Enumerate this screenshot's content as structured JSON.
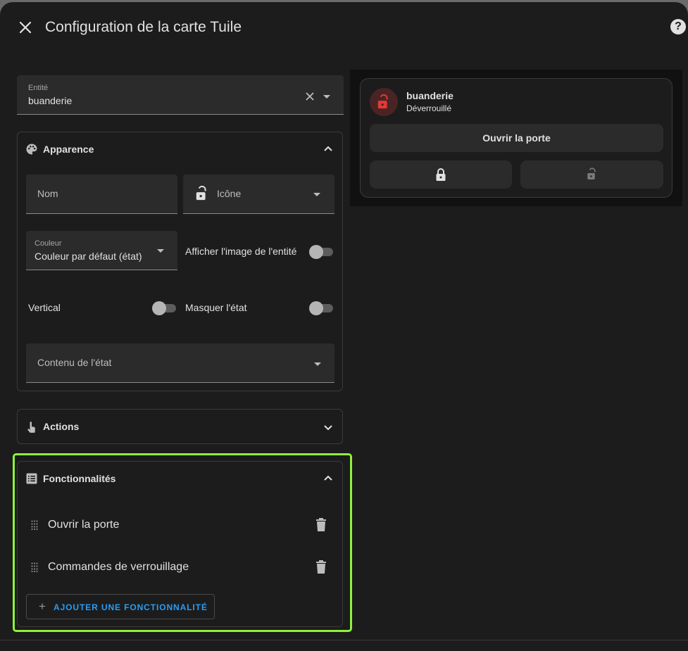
{
  "header": {
    "title": "Configuration de la carte Tuile",
    "close_icon": "close-icon",
    "help_label": "?"
  },
  "entity_field": {
    "label": "Entité",
    "value": "buanderie"
  },
  "appearance": {
    "title": "Apparence",
    "name_field": {
      "placeholder": "Nom"
    },
    "icon_field": {
      "placeholder": "Icône"
    },
    "color_field": {
      "label": "Couleur",
      "value": "Couleur par défaut (état)"
    },
    "show_entity_picture": {
      "label": "Afficher l'image de l'entité",
      "on": false
    },
    "vertical": {
      "label": "Vertical",
      "on": false
    },
    "hide_state": {
      "label": "Masquer l'état",
      "on": false
    },
    "state_content": {
      "placeholder": "Contenu de l'état"
    }
  },
  "actions": {
    "title": "Actions"
  },
  "features": {
    "title": "Fonctionnalités",
    "items": [
      {
        "label": "Ouvrir la porte"
      },
      {
        "label": "Commandes de verrouillage"
      }
    ],
    "add_label": "AJOUTER UNE FONCTIONNALITÉ"
  },
  "preview": {
    "name": "buanderie",
    "state": "Déverrouillé",
    "open_door_label": "Ouvrir la porte",
    "state_color": "#e53935"
  },
  "colors": {
    "accent": "#2a9df4",
    "highlight": "#8ef23c",
    "background": "#1c1c1c"
  }
}
